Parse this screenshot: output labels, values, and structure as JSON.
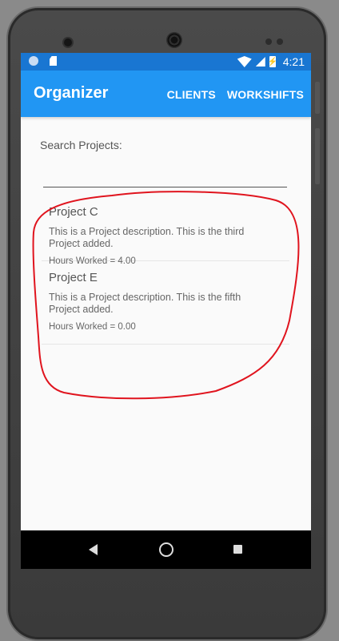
{
  "status_bar": {
    "time": "4:21",
    "battery_glyph": "⚡"
  },
  "app_bar": {
    "title": "Organizer",
    "actions": [
      "CLIENTS",
      "WORKSHIFTS"
    ]
  },
  "search": {
    "label": "Search Projects:",
    "value": ""
  },
  "projects": [
    {
      "title": "Project C",
      "description": "This is a Project description. This is the third Project added.",
      "hours": "Hours Worked = 4.00"
    },
    {
      "title": "Project E",
      "description": "This is a Project description. This is the fifth Project added.",
      "hours": "Hours Worked = 0.00"
    }
  ],
  "nav_bar": {
    "icons": [
      "back-icon",
      "home-icon",
      "recent-apps-icon"
    ]
  },
  "colors": {
    "status_bar": "#1976d2",
    "app_bar": "#2196f3",
    "annotation": "#e0141e"
  }
}
